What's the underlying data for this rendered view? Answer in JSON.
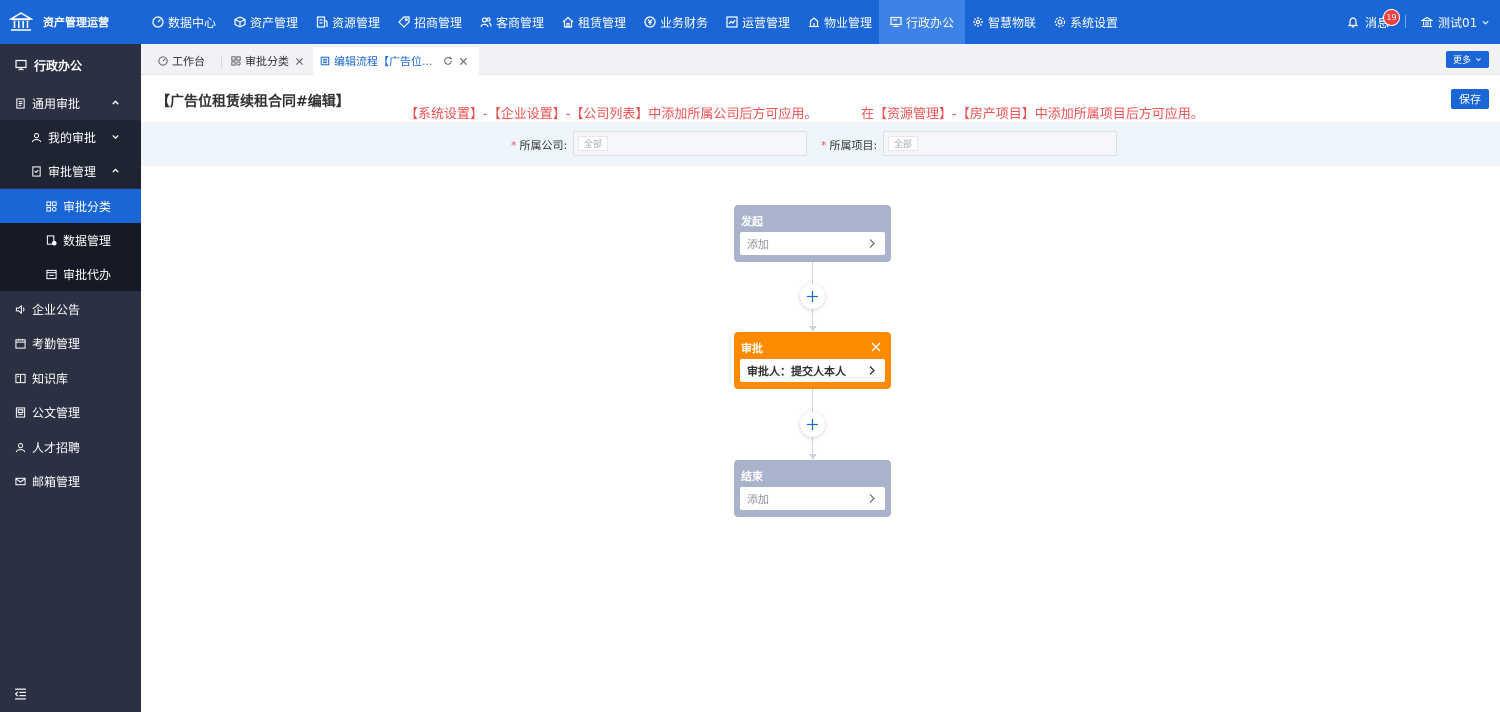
{
  "app": {
    "name": "资产管理运营"
  },
  "top_nav": {
    "items": [
      {
        "label": "数据中心",
        "icon": "dashboard-icon"
      },
      {
        "label": "资产管理",
        "icon": "cube-icon"
      },
      {
        "label": "资源管理",
        "icon": "building-icon"
      },
      {
        "label": "招商管理",
        "icon": "tag-icon"
      },
      {
        "label": "客商管理",
        "icon": "people-icon"
      },
      {
        "label": "租赁管理",
        "icon": "home-icon"
      },
      {
        "label": "业务财务",
        "icon": "currency-icon"
      },
      {
        "label": "运营管理",
        "icon": "chart-icon"
      },
      {
        "label": "物业管理",
        "icon": "property-icon"
      },
      {
        "label": "行政办公",
        "icon": "monitor-icon"
      },
      {
        "label": "智慧物联",
        "icon": "iot-icon"
      },
      {
        "label": "系统设置",
        "icon": "gear-icon"
      }
    ],
    "active": "行政办公",
    "messages_label": "消息",
    "messages_count": "19",
    "user_label": "测试01"
  },
  "sidebar": {
    "title": "行政办公",
    "items": [
      {
        "label": "通用审批",
        "icon": "document-icon",
        "expanded": true
      },
      {
        "label": "我的审批",
        "icon": "user-icon",
        "expanded": false
      },
      {
        "label": "审批管理",
        "icon": "checklist-icon",
        "expanded": true
      },
      {
        "label": "审批分类",
        "icon": "grid-icon",
        "active": true
      },
      {
        "label": "数据管理",
        "icon": "data-icon"
      },
      {
        "label": "审批代办",
        "icon": "todo-icon"
      },
      {
        "label": "企业公告",
        "icon": "speaker-icon"
      },
      {
        "label": "考勤管理",
        "icon": "calendar-icon"
      },
      {
        "label": "知识库",
        "icon": "book-icon"
      },
      {
        "label": "公文管理",
        "icon": "file-icon"
      },
      {
        "label": "人才招聘",
        "icon": "user-icon"
      },
      {
        "label": "邮箱管理",
        "icon": "mail-icon"
      }
    ]
  },
  "tabs": {
    "items": [
      {
        "label": "工作台",
        "icon": "dashboard-icon",
        "closable": false
      },
      {
        "label": "审批分类",
        "icon": "grid-icon",
        "closable": true
      },
      {
        "label": "编辑流程【广告位...",
        "icon": "document-icon",
        "closable": true,
        "active": true
      }
    ],
    "more_label": "更多"
  },
  "page": {
    "title": "【广告位租赁续租合同#编辑】",
    "notice_company": "【系统设置】-【企业设置】-【公司列表】中添加所属公司后方可应用。",
    "notice_project": "在【资源管理】-【房产项目】中添加所属项目后方可应用。",
    "save_label": "保存"
  },
  "filters": {
    "company_label": "所属公司:",
    "company_value": "全部",
    "project_label": "所属项目:",
    "project_value": "全部"
  },
  "flow": {
    "nodes": [
      {
        "title": "发起",
        "body": "添加",
        "type": "start"
      },
      {
        "title": "审批",
        "body": "审批人：提交人本人",
        "type": "approval"
      },
      {
        "title": "结束",
        "body": "添加",
        "type": "end"
      }
    ]
  },
  "colors": {
    "primary": "#1a66d6",
    "sidebar_bg": "#2b3043",
    "approval_node": "#fe8a00",
    "neutral_node": "#a9b4cc",
    "notice_text": "#f05050"
  }
}
